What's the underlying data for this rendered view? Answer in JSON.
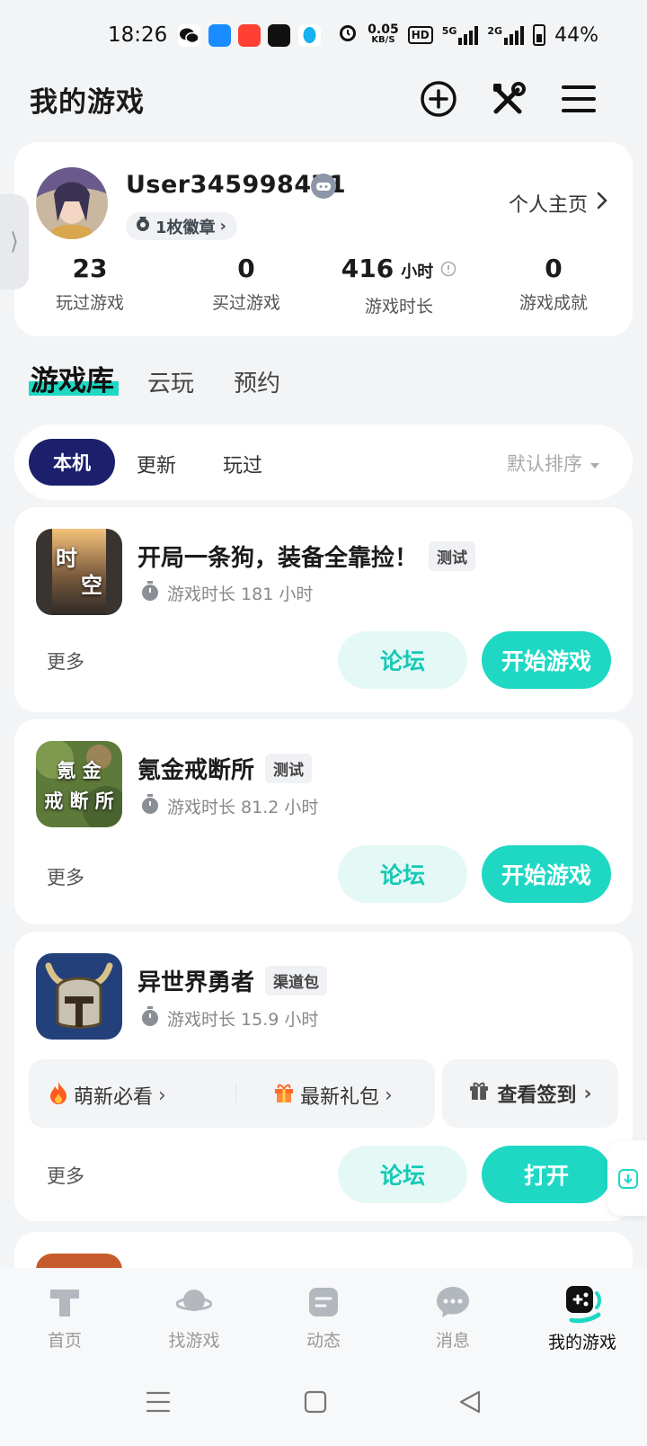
{
  "status_bar": {
    "time": "18:26",
    "net_speed": "0.05",
    "net_unit": "KB/S",
    "hd": "HD",
    "sim1": "5G",
    "sim2": "2G",
    "battery": "44%"
  },
  "header": {
    "title": "我的游戏",
    "icons": [
      "add-circle-icon",
      "tools-icon",
      "menu-icon"
    ]
  },
  "profile": {
    "username": "User345998471",
    "medals": "1枚徽章",
    "homepage_link": "个人主页",
    "stats": [
      {
        "value": "23",
        "unit": "",
        "label": "玩过游戏"
      },
      {
        "value": "0",
        "unit": "",
        "label": "买过游戏"
      },
      {
        "value": "416",
        "unit": "小时",
        "label": "游戏时长"
      },
      {
        "value": "0",
        "unit": "",
        "label": "游戏成就"
      }
    ]
  },
  "main_tabs": [
    "游戏库",
    "云玩",
    "预约"
  ],
  "filters": {
    "chips": [
      "本机",
      "更新",
      "玩过"
    ],
    "sort": "默认排序"
  },
  "games": [
    {
      "name": "开局一条狗，装备全靠捡！",
      "tag": "测试",
      "icon_text": [
        "时",
        "空"
      ],
      "playtime": "游戏时长 181 小时",
      "more": "更多",
      "forum": "论坛",
      "action": "开始游戏"
    },
    {
      "name": "氪金戒断所",
      "tag": "测试",
      "icon_text": [
        "氪 金",
        "戒 断 所"
      ],
      "playtime": "游戏时长 81.2 小时",
      "more": "更多",
      "forum": "论坛",
      "action": "开始游戏"
    },
    {
      "name": "异世界勇者",
      "tag": "渠道包",
      "playtime": "游戏时长 15.9 小时",
      "quick_links": [
        "萌新必看",
        "最新礼包"
      ],
      "sign_in": "查看签到",
      "more": "更多",
      "forum": "论坛",
      "action": "打开"
    }
  ],
  "bottom_nav": [
    {
      "label": "首页",
      "icon": "home-icon"
    },
    {
      "label": "找游戏",
      "icon": "planet-icon"
    },
    {
      "label": "动态",
      "icon": "feed-icon"
    },
    {
      "label": "消息",
      "icon": "chat-icon"
    },
    {
      "label": "我的游戏",
      "icon": "gamepad-icon",
      "active": true
    }
  ],
  "colors": {
    "accent": "#1ed8c4",
    "accent_light": "#e4f9f6",
    "chip_active": "#1c1f6b",
    "background": "#f2f4f6"
  }
}
